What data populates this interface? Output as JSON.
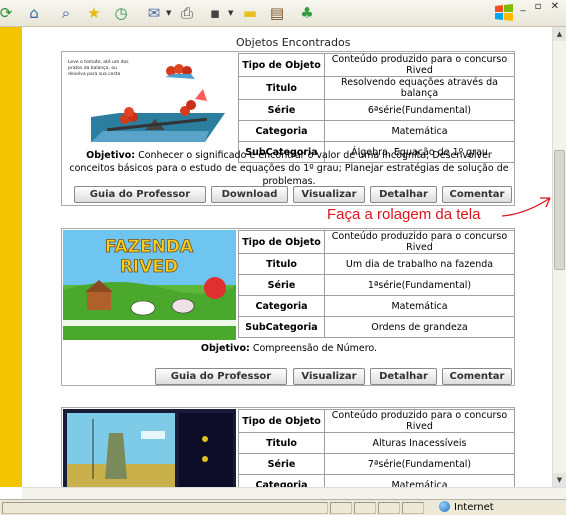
{
  "toolbar": {
    "icons": [
      "refresh-icon",
      "home-icon",
      "search-icon",
      "favorites-icon",
      "history-icon",
      "mail-icon",
      "print-icon",
      "edit-icon",
      "discuss-icon",
      "research-icon",
      "messenger-icon"
    ]
  },
  "page": {
    "heading": "Objetos Encontrados",
    "annotation": "Faça a rolagem da tela",
    "colors": {
      "strip": "#f5c400",
      "annotation": "#e0141e"
    }
  },
  "cards": [
    {
      "thumbnail_caption": "Leve o tomate, até um dos pratos da balança, ou devolva para sua cesta",
      "rows": [
        {
          "k": "Tipo de Objeto",
          "v": "Conteúdo produzido para o concurso Rived"
        },
        {
          "k": "Titulo",
          "v": "Resolvendo equações através da balança"
        },
        {
          "k": "Série",
          "v": "6ªsérie(Fundamental)"
        },
        {
          "k": "Categoria",
          "v": "Matemática"
        },
        {
          "k": "SubCategoria",
          "v": "Álgebra, Equação de 1º grau"
        }
      ],
      "objective_label": "Objetivo:",
      "objective": "Conhecer o significado e encontrar o valor de uma incógnita; Desenvolver conceitos básicos para o estudo de equações do 1º grau; Planejar estratégias de solução de problemas.",
      "buttons": [
        "Guia do Professor",
        "Download",
        "Visualizar",
        "Detalhar",
        "Comentar"
      ]
    },
    {
      "thumbnail_title": "FAZENDA RIVED",
      "rows": [
        {
          "k": "Tipo de Objeto",
          "v": "Conteúdo produzido para o concurso Rived"
        },
        {
          "k": "Titulo",
          "v": "Um dia de trabalho na fazenda"
        },
        {
          "k": "Série",
          "v": "1ªsérie(Fundamental)"
        },
        {
          "k": "Categoria",
          "v": "Matemática"
        },
        {
          "k": "SubCategoria",
          "v": "Ordens de grandeza"
        }
      ],
      "objective_label": "Objetivo:",
      "objective": "Compreensão de Número.",
      "buttons": [
        "Guia do Professor",
        "Visualizar",
        "Detalhar",
        "Comentar"
      ]
    },
    {
      "rows": [
        {
          "k": "Tipo de Objeto",
          "v": "Conteúdo produzido para o concurso Rived"
        },
        {
          "k": "Titulo",
          "v": "Alturas Inacessíveis"
        },
        {
          "k": "Série",
          "v": "7ªsérie(Fundamental)"
        },
        {
          "k": "Categoria",
          "v": "Matemática"
        }
      ]
    }
  ],
  "statusbar": {
    "zone": "Internet"
  }
}
